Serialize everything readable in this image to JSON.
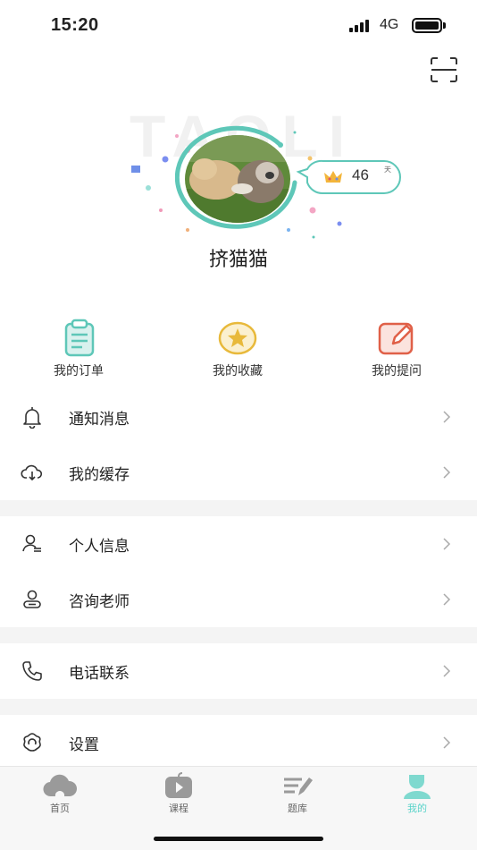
{
  "status_bar": {
    "time": "15:20",
    "network": "4G",
    "signal": "signal-bars-icon",
    "battery": "battery-full-icon"
  },
  "header": {
    "scan_icon": "scan-icon"
  },
  "profile": {
    "watermark": "TAOLI",
    "username": "挤猫猫",
    "badge": {
      "icon": "crown-icon",
      "value": "46",
      "unit": "天"
    },
    "avatar": "cats-photo"
  },
  "quick_actions": [
    {
      "label": "我的订单",
      "icon": "clipboard-icon"
    },
    {
      "label": "我的收藏",
      "icon": "star-icon"
    },
    {
      "label": "我的提问",
      "icon": "edit-icon"
    }
  ],
  "menu": {
    "notifications": "通知消息",
    "cache": "我的缓存",
    "personal_info": "个人信息",
    "consult_teacher": "咨询老师",
    "phone_contact": "电话联系",
    "settings": "设置"
  },
  "tab_bar": {
    "items": [
      {
        "label": "首页",
        "icon": "cloud-icon"
      },
      {
        "label": "课程",
        "icon": "tv-play-icon"
      },
      {
        "label": "题库",
        "icon": "question-bank-icon"
      },
      {
        "label": "我的",
        "icon": "person-icon",
        "active": true
      }
    ]
  },
  "colors": {
    "accent": "#58d3c9",
    "ring": "#5ec7b8",
    "star": "#e8b93b",
    "edit": "#e06048"
  }
}
